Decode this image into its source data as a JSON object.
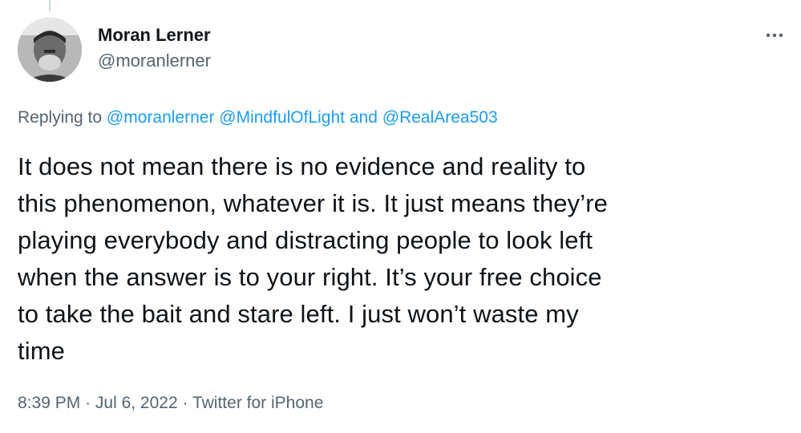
{
  "tweet": {
    "author": {
      "display_name": "Moran Lerner",
      "handle": "@moranlerner"
    },
    "replying": {
      "prefix": "Replying to",
      "mentions": [
        "@moranlerner",
        "@MindfulOfLight"
      ],
      "conjunction": "and",
      "last_mention": "@RealArea503"
    },
    "text_lines": [
      "It does not mean there is no evidence and reality to",
      "this phenomenon, whatever it is. It just means they’re",
      "playing everybody and distracting people to look left",
      "when the answer is to your right. It’s your free choice",
      "to take the bait and stare left. I just won’t waste my",
      "time"
    ],
    "meta": {
      "time": "8:39 PM",
      "separator": "·",
      "date": "Jul 6, 2022",
      "source": "Twitter for iPhone"
    }
  },
  "icons": {
    "more": "more-horizontal-icon",
    "avatar": "avatar"
  },
  "colors": {
    "text": "#0f1419",
    "secondary": "#536471",
    "link": "#1d9bf0",
    "thread_line": "#cfd9de"
  }
}
